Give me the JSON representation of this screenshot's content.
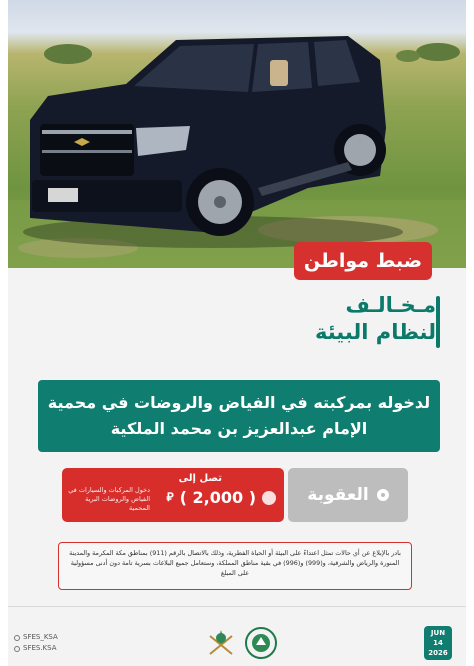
{
  "headline": {
    "tag": "ضبط مواطن",
    "violator_line1": "مـخـالـف",
    "violator_line2": "لنظام البيئة"
  },
  "description": {
    "line1": "لدخوله بمركبته في الفياض والروضات في محمية",
    "line2": "الإمام عبدالعزيز بن محمد الملكية"
  },
  "penalty": {
    "label": "العقوبة"
  },
  "fine": {
    "up_to": "تصل إلى",
    "amount": "( 2,000 )",
    "currency": "⃁",
    "note": "دخول المركبات والسيارات في الفياض والروضات البرية المحمية"
  },
  "notice": {
    "text": "بادر بالإبلاغ عن أي حالات تمثل اعتداءً على البيئة أو الحياة الفطرية، وذلك بالاتصال بالرقم (911) بمناطق مكة المكرمة والمدينة المنورة والرياض والشرقية، و(999) و(996) في بقية مناطق المملكة، وستعامل جميع البلاغات بسرية تامة دون أدنى مسؤولية على المبلغ"
  },
  "footer": {
    "social": [
      "SFES_KSA",
      "SFES.KSA"
    ],
    "date": {
      "month": "JUN",
      "day": "14",
      "year": "2026"
    }
  },
  "colors": {
    "teal": "#0f7d6f",
    "red": "#d6312f",
    "gray": "#bdbdbd"
  },
  "icons": [
    "car-photo",
    "penalty-icon",
    "coin-icon",
    "x-logo-icon",
    "instagram-icon",
    "emblem-logo",
    "ministry-logo"
  ]
}
